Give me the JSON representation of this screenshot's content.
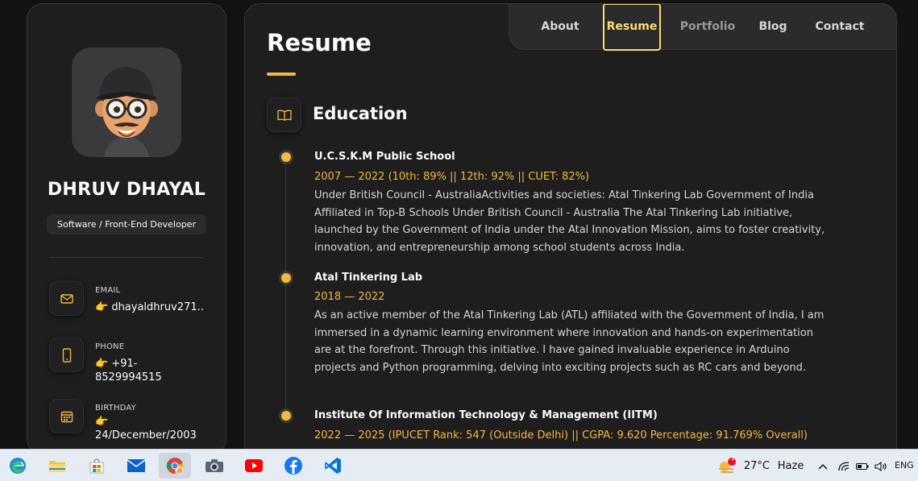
{
  "profile": {
    "name": "DHRUV DHAYAL",
    "role": "Software / Front-End Developer",
    "contacts": [
      {
        "label": "EMAIL",
        "value": "👉 dhayaldhruv271...",
        "icon": "mail-icon"
      },
      {
        "label": "PHONE",
        "value": "👉 +91-8529994515",
        "icon": "phone-icon"
      },
      {
        "label": "BIRTHDAY",
        "value": "👉 24/December/2003",
        "icon": "calendar-icon"
      }
    ]
  },
  "nav": {
    "items": [
      {
        "label": "About"
      },
      {
        "label": "Resume",
        "active": true
      },
      {
        "label": "Portfolio"
      },
      {
        "label": "Blog"
      },
      {
        "label": "Contact"
      }
    ]
  },
  "resume": {
    "title": "Resume",
    "education": {
      "title": "Education",
      "items": [
        {
          "title": "U.C.S.K.M Public School",
          "date": "2007 — 2022 (10th: 89% || 12th: 92% || CUET: 82%)",
          "text": "Under British Council - AustraliaActivities and societies: Atal Tinkering Lab Government of India Affiliated in Top-B Schools Under British Council - Australia The Atal Tinkering Lab initiative, launched by the Government of India under the Atal Innovation Mission, aims to foster creativity, innovation, and entrepreneurship among school students across India."
        },
        {
          "title": "Atal Tinkering Lab",
          "date": "2018 — 2022",
          "text": "As an active member of the Atal Tinkering Lab (ATL) affiliated with the Government of India, I am immersed in a dynamic learning environment where innovation and hands-on experimentation are at the forefront. Through this initiative. I have gained invaluable experience in Arduino projects and Python programming, delving into exciting projects such as RC cars and beyond."
        },
        {
          "title": "Institute Of Information Technology & Management (IITM)",
          "date": "2022 — 2025 (IPUCET Rank: 547 (Outside Delhi) || CGPA: 9.620 Percentage: 91.769% Overall)",
          "text": ""
        }
      ]
    }
  },
  "taskbar": {
    "apps": [
      "edge-icon",
      "file-explorer-icon",
      "store-icon",
      "mail-app-icon",
      "chrome-icon",
      "camera-icon",
      "youtube-icon",
      "facebook-icon",
      "vscode-icon"
    ],
    "weather": {
      "temp": "27°C",
      "condition": "Haze",
      "badge": "1"
    },
    "language": "ENG"
  },
  "colors": {
    "accent": "#f6b93b",
    "nav_active": "#ffdb70",
    "bg": "#121212",
    "card": "#1e1e1f"
  }
}
